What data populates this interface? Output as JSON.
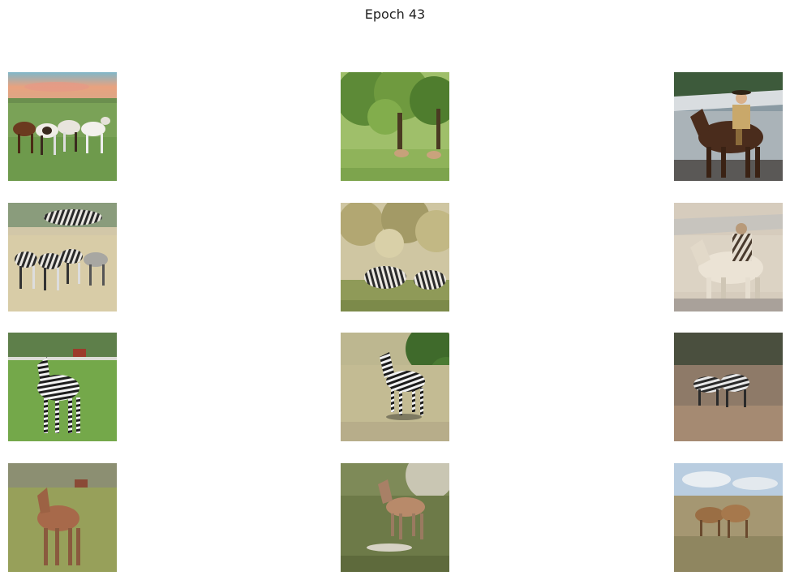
{
  "title": "Epoch 43",
  "grid": {
    "rows": 4,
    "cols": 3,
    "images": [
      [
        "horses-running-sunset",
        "trees-with-horses",
        "cowboy-on-horse"
      ],
      [
        "generated-zebras-from-horses",
        "generated-zebras-under-trees",
        "generated-zebra-rider"
      ],
      [
        "zebra-in-pasture",
        "zebra-running",
        "zebras-grazing"
      ],
      [
        "generated-horse-from-zebra",
        "generated-horse-running",
        "generated-horses-grazing"
      ]
    ]
  }
}
